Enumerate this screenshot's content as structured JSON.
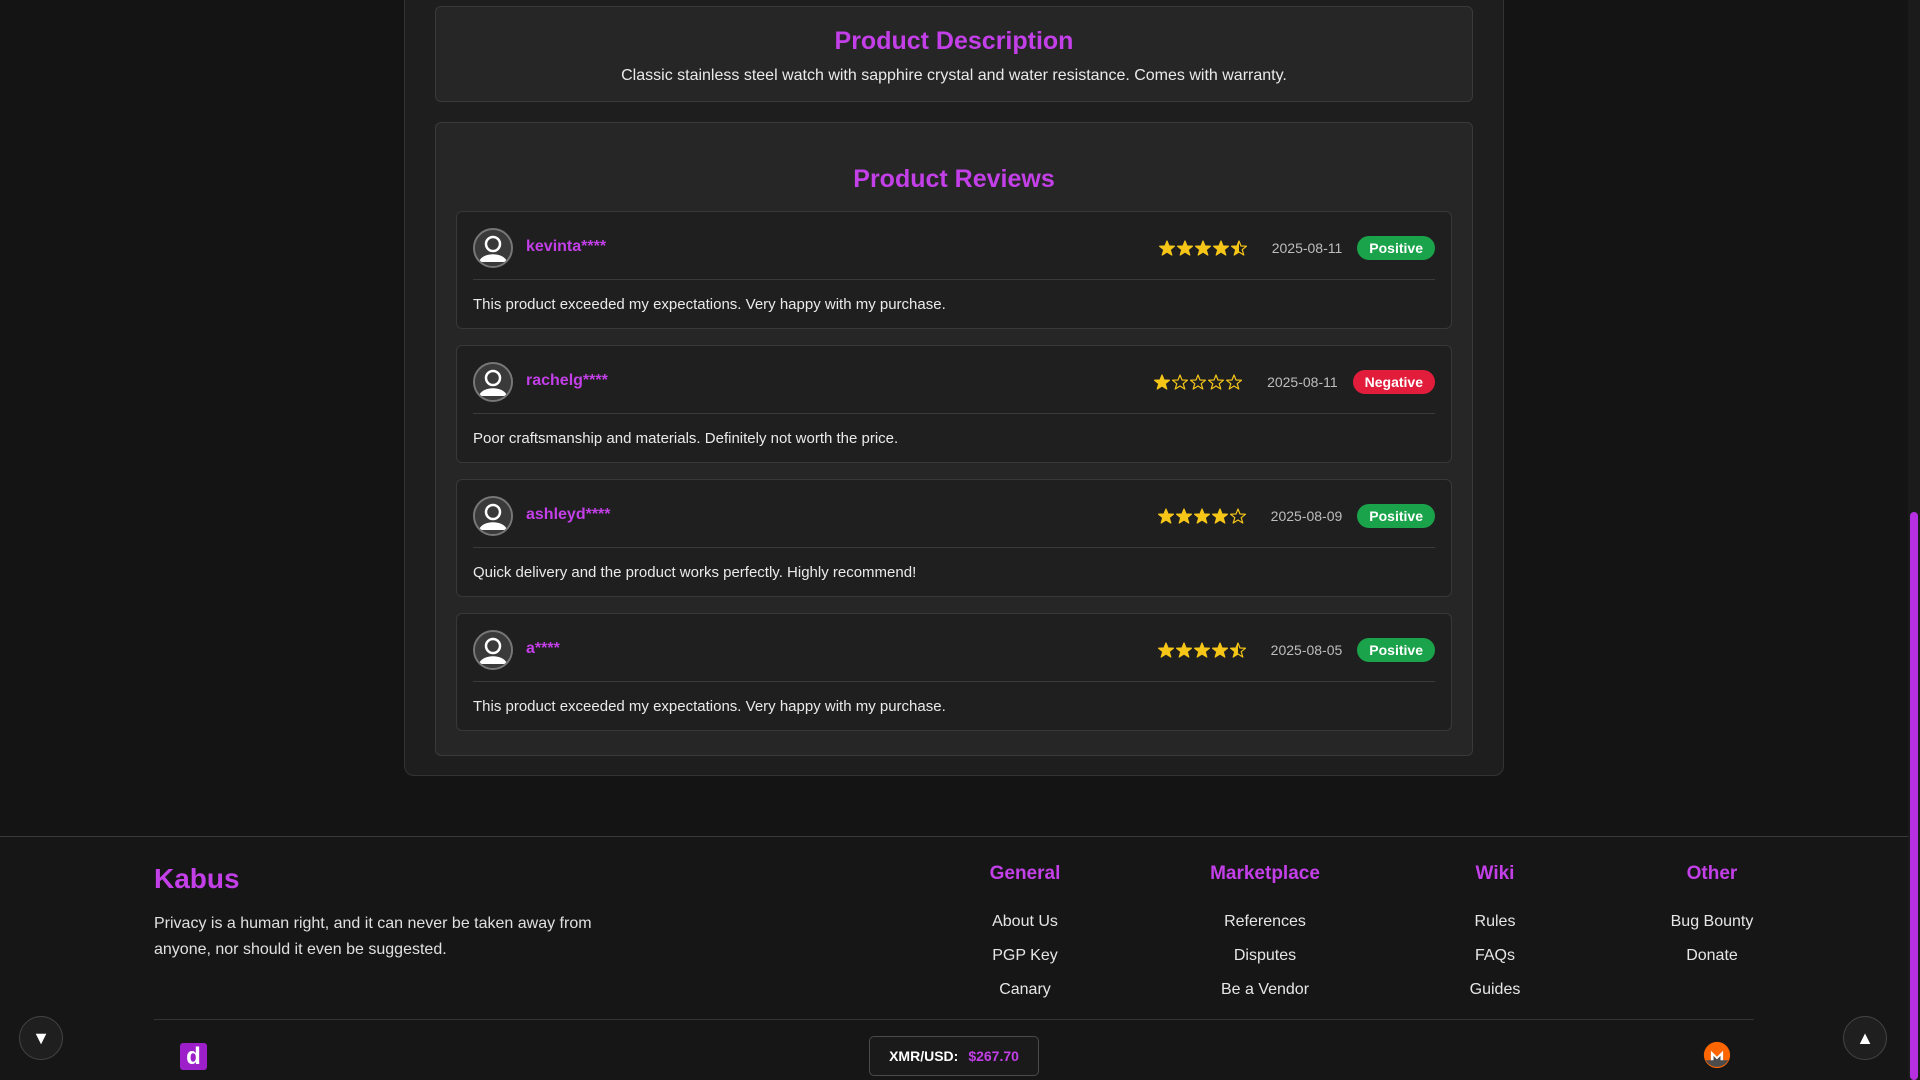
{
  "description": {
    "title": "Product Description",
    "text": "Classic stainless steel watch with sapphire crystal and water resistance. Comes with warranty."
  },
  "reviews": {
    "title": "Product Reviews",
    "items": [
      {
        "user": "kevinta****",
        "rating": 4.5,
        "date": "2025-08-11",
        "sentiment": "Positive",
        "text": "This product exceeded my expectations. Very happy with my purchase."
      },
      {
        "user": "rachelg****",
        "rating": 1,
        "date": "2025-08-11",
        "sentiment": "Negative",
        "text": "Poor craftsmanship and materials. Definitely not worth the price."
      },
      {
        "user": "ashleyd****",
        "rating": 4,
        "date": "2025-08-09",
        "sentiment": "Positive",
        "text": "Quick delivery and the product works perfectly. Highly recommend!"
      },
      {
        "user": "a****",
        "rating": 4.5,
        "date": "2025-08-05",
        "sentiment": "Positive",
        "text": "This product exceeded my expectations. Very happy with my purchase."
      }
    ]
  },
  "footer": {
    "brand": "Kabus",
    "tagline": "Privacy is a human right, and it can never be taken away from anyone, nor should it even be suggested.",
    "columns": [
      {
        "title": "General",
        "links": [
          "About Us",
          "PGP Key",
          "Canary"
        ]
      },
      {
        "title": "Marketplace",
        "links": [
          "References",
          "Disputes",
          "Be a Vendor"
        ]
      },
      {
        "title": "Wiki",
        "links": [
          "Rules",
          "FAQs",
          "Guides"
        ]
      },
      {
        "title": "Other",
        "links": [
          "Bug Bounty",
          "Donate"
        ]
      }
    ],
    "rate_label": "XMR/USD:",
    "rate_value": "$267.70",
    "logo_letter": "d"
  },
  "icons": {
    "scroll_down": "triangle-down-icon",
    "scroll_up": "triangle-up-icon",
    "avatar": "user-icon",
    "star": "star-icon",
    "monero": "monero-icon"
  },
  "colors": {
    "accent": "#c33fe8",
    "positive": "#1aa34a",
    "negative": "#e21d3c",
    "star": "#f5c518"
  }
}
